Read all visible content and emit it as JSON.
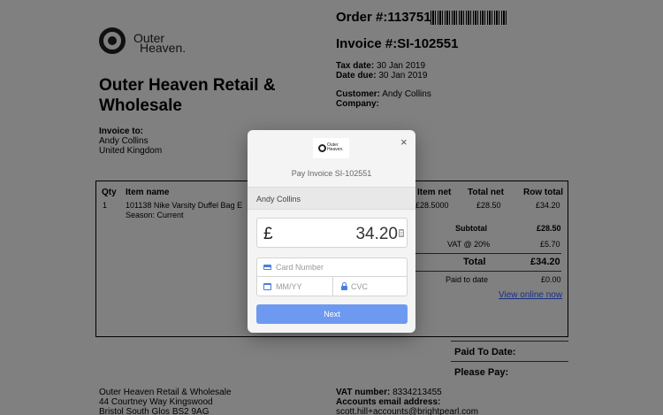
{
  "logo": {
    "line1": "Outer",
    "line2": "Heaven."
  },
  "order": {
    "label": "Order #:",
    "number": "113751"
  },
  "invoice": {
    "label": "Invoice #:",
    "number": "SI-102551"
  },
  "dates": {
    "tax_label": "Tax date:",
    "tax_value": "30 Jan 2019",
    "due_label": "Date due:",
    "due_value": "30 Jan 2019"
  },
  "customer": {
    "label": "Customer:",
    "value": "Andy Collins",
    "company_label": "Company:"
  },
  "company_name_line1": "Outer Heaven Retail &",
  "company_name_line2": "Wholesale",
  "invoice_to": {
    "label": "Invoice to:",
    "name": "Andy Collins",
    "country": "United Kingdom"
  },
  "table": {
    "headers": {
      "qty": "Qty",
      "item": "Item name",
      "item_net": "Item net",
      "total_net": "Total net",
      "row_total": "Row total"
    },
    "rows": [
      {
        "qty": "1",
        "item": "101138 Nike Varsity Duffel Bag E",
        "item_sub": "Season: Current",
        "item_net": "£28.5000",
        "total_net": "£28.50",
        "row_total": "£34.20"
      }
    ]
  },
  "totals": {
    "subtotal_label": "Subtotal",
    "subtotal_value": "£28.50",
    "vat_label": "VAT @ 20%",
    "vat_value": "£5.70",
    "total_label": "Total",
    "total_value": "£34.20",
    "paid_label": "Paid to date",
    "paid_value": "£0.00",
    "view_online": "View online now"
  },
  "payment_summary": {
    "paid_to_date": "Paid To Date:",
    "please_pay": "Please Pay:"
  },
  "footer": {
    "address_line1": "Outer Heaven Retail & Wholesale",
    "address_line2": "44 Courtney Way Kingswood",
    "address_line3": "Bristol South Glos BS2 9AG",
    "vat_label": "VAT number:",
    "vat_value": "8334213455",
    "email_label": "Accounts email address:",
    "email_value": "scott.hill+accounts@brightpearl.com"
  },
  "modal": {
    "logo_line1": "Outer",
    "logo_line2": "Heaven.",
    "close": "×",
    "title": "Pay Invoice SI-102551",
    "customer_name": "Andy Collins",
    "currency_symbol": "£",
    "amount": "34.20",
    "card_number_placeholder": "Card Number",
    "expiry_placeholder": "MM/YY",
    "cvc_placeholder": "CVC",
    "next_label": "Next",
    "accent_color": "#6d9af0"
  }
}
